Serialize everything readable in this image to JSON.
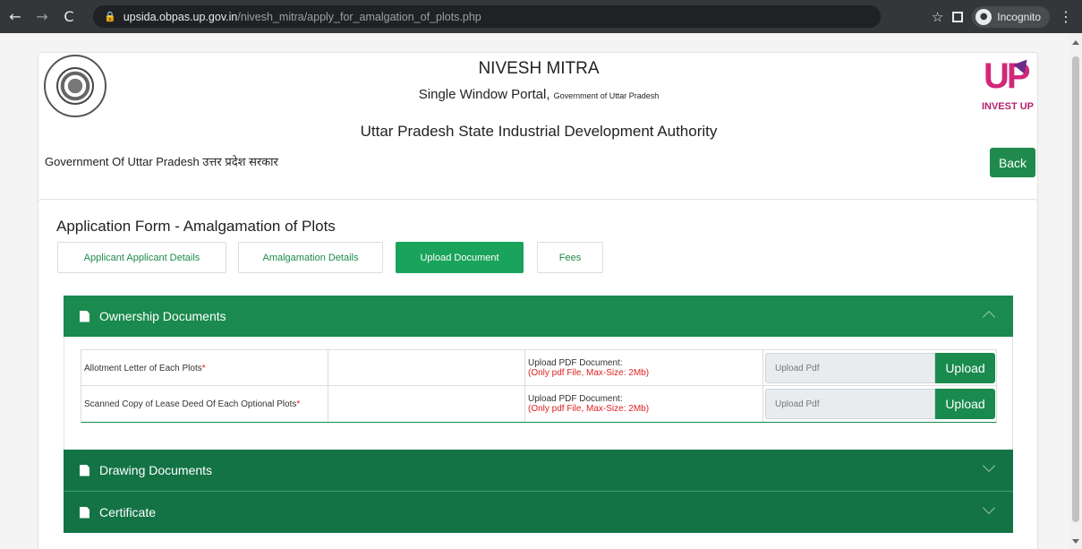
{
  "browser": {
    "url_host": "upsida.obpas.up.gov.in",
    "url_path": "/nivesh_mitra/apply_for_amalgation_of_plots.php",
    "incognito_label": "Incognito"
  },
  "header": {
    "title": "NIVESH MITRA",
    "subtitle_main": "Single Window Portal,",
    "subtitle_small": "Government of Uttar Pradesh",
    "authority": "Uttar Pradesh State Industrial Development Authority",
    "gov_label": "Government Of Uttar Pradesh उत्तर प्रदेश सरकार",
    "logo_text": "INVEST UP",
    "back_label": "Back"
  },
  "form": {
    "title": "Application Form - Amalgamation of Plots",
    "tabs": [
      {
        "label": "Applicant Applicant Details",
        "active": false
      },
      {
        "label": "Amalgamation Details",
        "active": false
      },
      {
        "label": "Upload Document",
        "active": true
      },
      {
        "label": "Fees",
        "active": false
      }
    ]
  },
  "accordion": {
    "sections": [
      {
        "label": "Ownership Documents",
        "expanded": true
      },
      {
        "label": "Drawing Documents",
        "expanded": false
      },
      {
        "label": "Certificate",
        "expanded": false
      }
    ]
  },
  "documents": [
    {
      "name": "Allotment Letter of Each Plots",
      "required_mark": "*",
      "upload_label": "Upload PDF Document:",
      "upload_hint": "(Only pdf File, Max-Size: 2Mb)",
      "placeholder": "Upload Pdf",
      "button": "Upload"
    },
    {
      "name": "Scanned Copy of Lease Deed Of Each Optional Plots",
      "required_mark": "*",
      "upload_label": "Upload PDF Document:",
      "upload_hint": "(Only pdf File, Max-Size: 2Mb)",
      "placeholder": "Upload Pdf",
      "button": "Upload"
    }
  ],
  "colors": {
    "accent": "#1a8a4e",
    "accent_dark": "#137345",
    "active_tab": "#1aa35a",
    "required": "#e02020"
  }
}
